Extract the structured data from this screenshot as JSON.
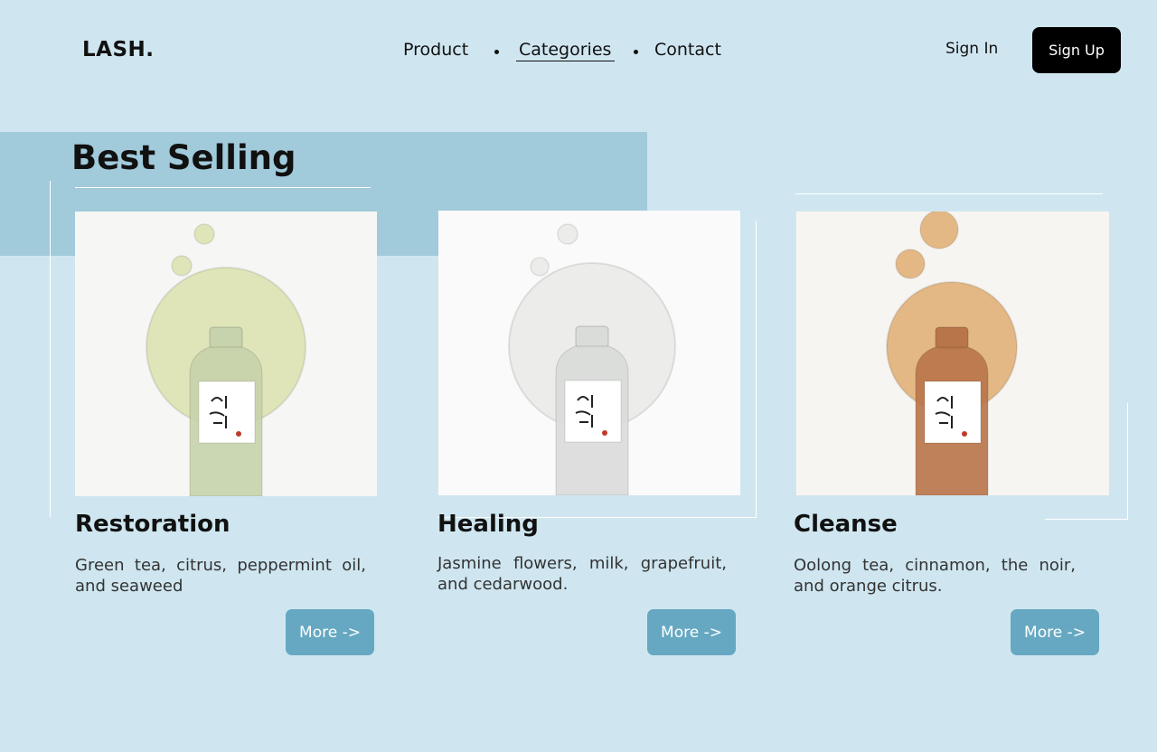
{
  "brand": {
    "logo": "LASH."
  },
  "nav": {
    "items": [
      {
        "label": "Product"
      },
      {
        "label": "Categories",
        "active": true
      },
      {
        "label": "Contact"
      }
    ]
  },
  "auth": {
    "sign_in": "Sign In",
    "sign_up": "Sign Up"
  },
  "section": {
    "title": "Best Selling"
  },
  "products": [
    {
      "name": "Restoration",
      "description": "Green tea, citrus, peppermint oil, and seaweed",
      "button": "More ->",
      "oil_color": "#dfe5b9",
      "bottle_color": "#c7d3ac",
      "bg_color": "#f6f6f5",
      "label_text": "조선\n미녀"
    },
    {
      "name": "Healing",
      "description": "Jasmine flowers, milk, grapefruit, and cedarwood.",
      "button": "More ->",
      "oil_color": "#ececea",
      "bottle_color": "#dadcda",
      "bg_color": "#fafafa",
      "label_text": "조선\n미녀"
    },
    {
      "name": "Cleanse",
      "description": "Oolong tea, cinnamon, the noir, and orange citrus.",
      "button": "More ->",
      "oil_color": "#e3b885",
      "bottle_color": "#b9754a",
      "bg_color": "#f7f5f2",
      "label_text": "조선\n미녀"
    }
  ],
  "colors": {
    "background": "#cfe6f0",
    "band": "#a1cadb",
    "more_button": "#66a8c2",
    "signup_button": "#000000"
  }
}
